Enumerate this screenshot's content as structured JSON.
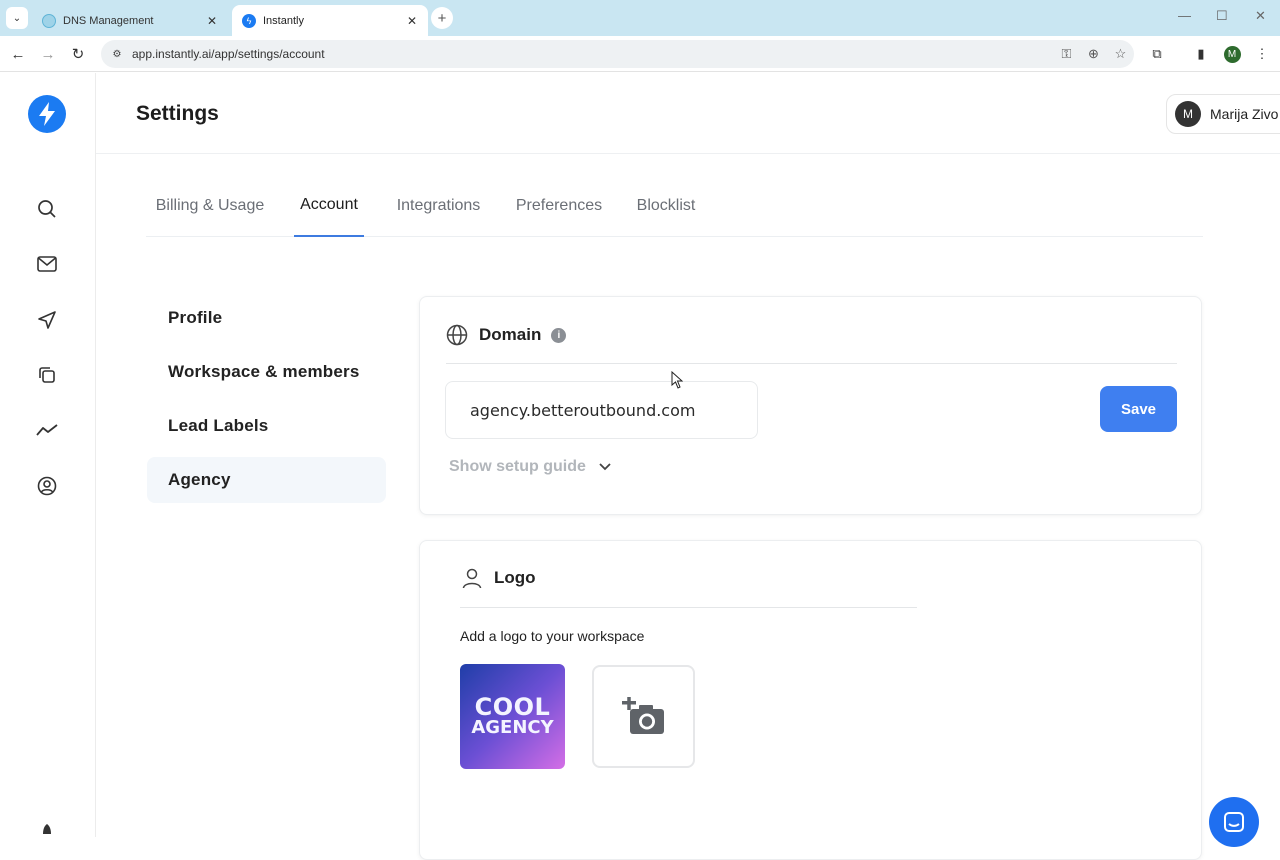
{
  "browser": {
    "tabs": [
      {
        "title": "DNS Management",
        "active": false
      },
      {
        "title": "Instantly",
        "active": true
      }
    ],
    "url": "app.instantly.ai/app/settings/account",
    "profile_initial": "M"
  },
  "header": {
    "title": "Settings",
    "user_initial": "M",
    "user_name": "Marija Zivo"
  },
  "settings_tabs": [
    "Billing & Usage",
    "Account",
    "Integrations",
    "Preferences",
    "Blocklist"
  ],
  "active_settings_tab": "Account",
  "subnav": [
    "Profile",
    "Workspace & members",
    "Lead Labels",
    "Agency"
  ],
  "active_subnav": "Agency",
  "domain_card": {
    "title": "Domain",
    "input_value": "agency.betteroutbound.com",
    "save_label": "Save",
    "guide_label": "Show setup guide"
  },
  "logo_card": {
    "title": "Logo",
    "description": "Add a logo to your workspace",
    "logo_line1": "COOL",
    "logo_line2": "AGENCY"
  },
  "colors": {
    "brand": "#1b7bf2",
    "primary_button": "#3f7ff0",
    "tab_underline": "#3d7be0"
  }
}
